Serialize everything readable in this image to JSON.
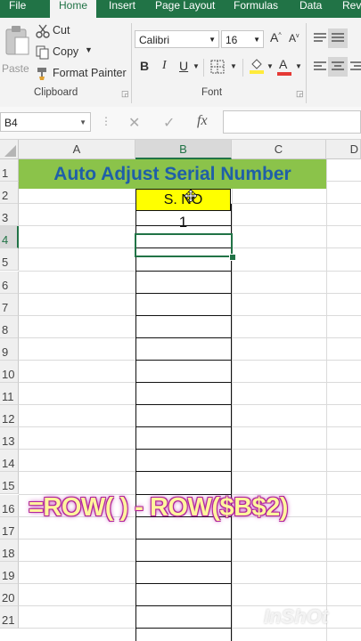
{
  "ribbon_tabs": [
    "File",
    "Home",
    "Insert",
    "Page Layout",
    "Formulas",
    "Data",
    "Rev"
  ],
  "clipboard": {
    "paste": "Paste",
    "cut": "Cut",
    "copy": "Copy",
    "format_painter": "Format Painter",
    "group_label": "Clipboard"
  },
  "font": {
    "family": "Calibri",
    "size": "16",
    "bold": "B",
    "italic": "I",
    "underline": "U",
    "grow": "A",
    "shrink": "A",
    "font_color_letter": "A",
    "group_label": "Font"
  },
  "formula_bar": {
    "name_box": "B4",
    "fx": "fx",
    "cancel": "✕",
    "enter": "✓"
  },
  "columns": [
    "A",
    "B",
    "C",
    "D"
  ],
  "rows": [
    "1",
    "2",
    "3",
    "4",
    "5",
    "6",
    "7",
    "8",
    "9",
    "10",
    "11",
    "12",
    "13",
    "14",
    "15",
    "16",
    "17",
    "18",
    "19",
    "20",
    "21"
  ],
  "cells": {
    "title": "Auto Adjust Serial Number",
    "header": "S. NO",
    "b3": "1"
  },
  "overlay": {
    "formula": "=ROW( ) - ROW($B$2)",
    "watermark": "InShOt"
  },
  "colors": {
    "excel_green": "#217346",
    "title_fill": "#8bc34a",
    "title_text": "#1f5fa8",
    "header_fill": "#ffff00",
    "fill_icon": "#ffeb3b",
    "font_icon": "#e53935"
  }
}
